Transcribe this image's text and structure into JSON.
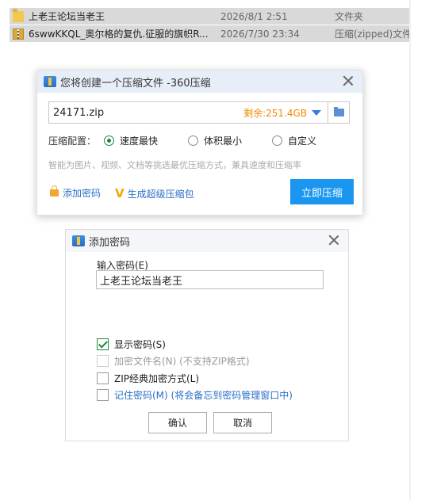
{
  "explorer": {
    "files": [
      {
        "name": "上老王论坛当老王",
        "date": "2026/8/1 2:51",
        "type": "文件夹",
        "icon": "folder-icon"
      },
      {
        "name": "6swwKKQL_奥尔格的复仇.征服的旗帜R...",
        "date": "2026/7/30 23:34",
        "type": "压缩(zipped)文件",
        "icon": "zip-icon"
      }
    ]
  },
  "compress_dialog": {
    "title": "您将创建一个压缩文件 -360压缩",
    "filename": "24171.zip",
    "free_space": "剩余:251.4GB",
    "config_label": "压缩配置：",
    "options": [
      "速度最快",
      "体积最小",
      "自定义"
    ],
    "selected_option": "速度最快",
    "hint": "智能为图片、视频、文档等挑选最优压缩方式，兼具速度和压缩率",
    "add_password_link": "添加密码",
    "super_pack_link": "生成超级压缩包",
    "compress_button": "立即压缩",
    "accent_color": "#1a96f0"
  },
  "password_dialog": {
    "title": "添加密码",
    "input_label": "输入密码(E)",
    "password_value": "上老王论坛当老王",
    "checkboxes": [
      {
        "label": "显示密码(S)",
        "checked": true,
        "enabled": true
      },
      {
        "label": "加密文件名(N) (不支持ZIP格式)",
        "checked": false,
        "enabled": false
      },
      {
        "label": "ZIP经典加密方式(L)",
        "checked": false,
        "enabled": true
      },
      {
        "label": "记住密码(M) (将会备忘到密码管理窗口中)",
        "checked": false,
        "enabled": true
      }
    ],
    "ok_button": "确认",
    "cancel_button": "取消"
  }
}
